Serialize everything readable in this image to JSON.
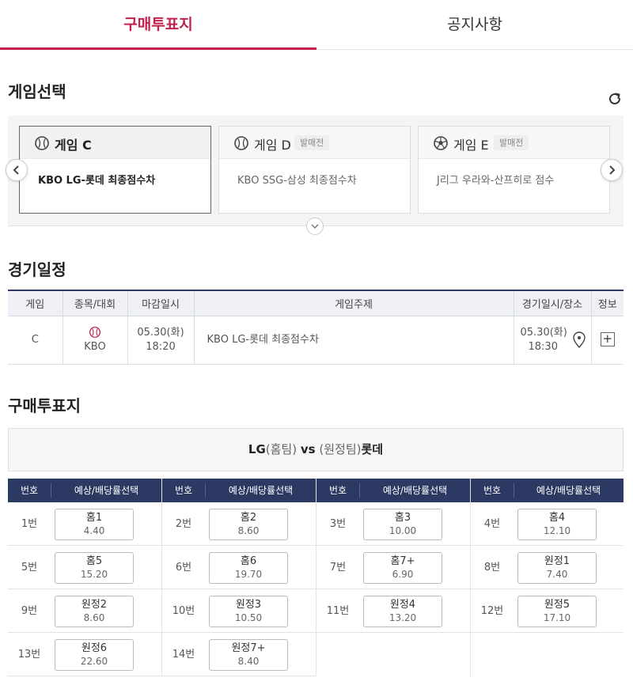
{
  "tabs": [
    {
      "label": "구매투표지",
      "active": true
    },
    {
      "label": "공지사항",
      "active": false
    }
  ],
  "game_select": {
    "title": "게임선택",
    "refresh_icon": "refresh-icon",
    "cards": [
      {
        "name": "게임 C",
        "badge": "",
        "sport_icon": "baseball-icon",
        "desc": "KBO LG-롯데 최종점수차",
        "active": true
      },
      {
        "name": "게임 D",
        "badge": "발매전",
        "sport_icon": "baseball-icon",
        "desc": "KBO SSG-삼성 최종점수차",
        "active": false
      },
      {
        "name": "게임 E",
        "badge": "발매전",
        "sport_icon": "soccer-icon",
        "desc": "J리그 우라와-산프히로 점수",
        "active": false
      }
    ]
  },
  "schedule": {
    "title": "경기일정",
    "headers": [
      "게임",
      "종목/대회",
      "마감일시",
      "게임주제",
      "경기일시/장소",
      "정보"
    ],
    "row": {
      "game": "C",
      "league": "KBO",
      "deadline_date": "05.30(화)",
      "deadline_time": "18:20",
      "subject": "KBO LG-롯데 최종점수차",
      "match_date": "05.30(화)",
      "match_time": "18:30",
      "info": "+"
    }
  },
  "slip": {
    "title": "구매투표지",
    "home": "LG",
    "home_tag": "(홈팀)",
    "vs": "vs",
    "away_tag": "(원정팀)",
    "away": "롯데",
    "col_headers": {
      "num": "번호",
      "pick": "예상/배당률선택"
    },
    "bets": [
      {
        "num": "1번",
        "label": "홈1",
        "odds": "4.40"
      },
      {
        "num": "2번",
        "label": "홈2",
        "odds": "8.60"
      },
      {
        "num": "3번",
        "label": "홈3",
        "odds": "10.00"
      },
      {
        "num": "4번",
        "label": "홈4",
        "odds": "12.10"
      },
      {
        "num": "5번",
        "label": "홈5",
        "odds": "15.20"
      },
      {
        "num": "6번",
        "label": "홈6",
        "odds": "19.70"
      },
      {
        "num": "7번",
        "label": "홈7+",
        "odds": "6.90"
      },
      {
        "num": "8번",
        "label": "원정1",
        "odds": "7.40"
      },
      {
        "num": "9번",
        "label": "원정2",
        "odds": "8.60"
      },
      {
        "num": "10번",
        "label": "원정3",
        "odds": "10.50"
      },
      {
        "num": "11번",
        "label": "원정4",
        "odds": "13.20"
      },
      {
        "num": "12번",
        "label": "원정5",
        "odds": "17.10"
      },
      {
        "num": "13번",
        "label": "원정6",
        "odds": "22.60"
      },
      {
        "num": "14번",
        "label": "원정7+",
        "odds": "8.40"
      }
    ]
  },
  "colors": {
    "accent": "#c1224c",
    "header_navy": "#2c3a63"
  }
}
